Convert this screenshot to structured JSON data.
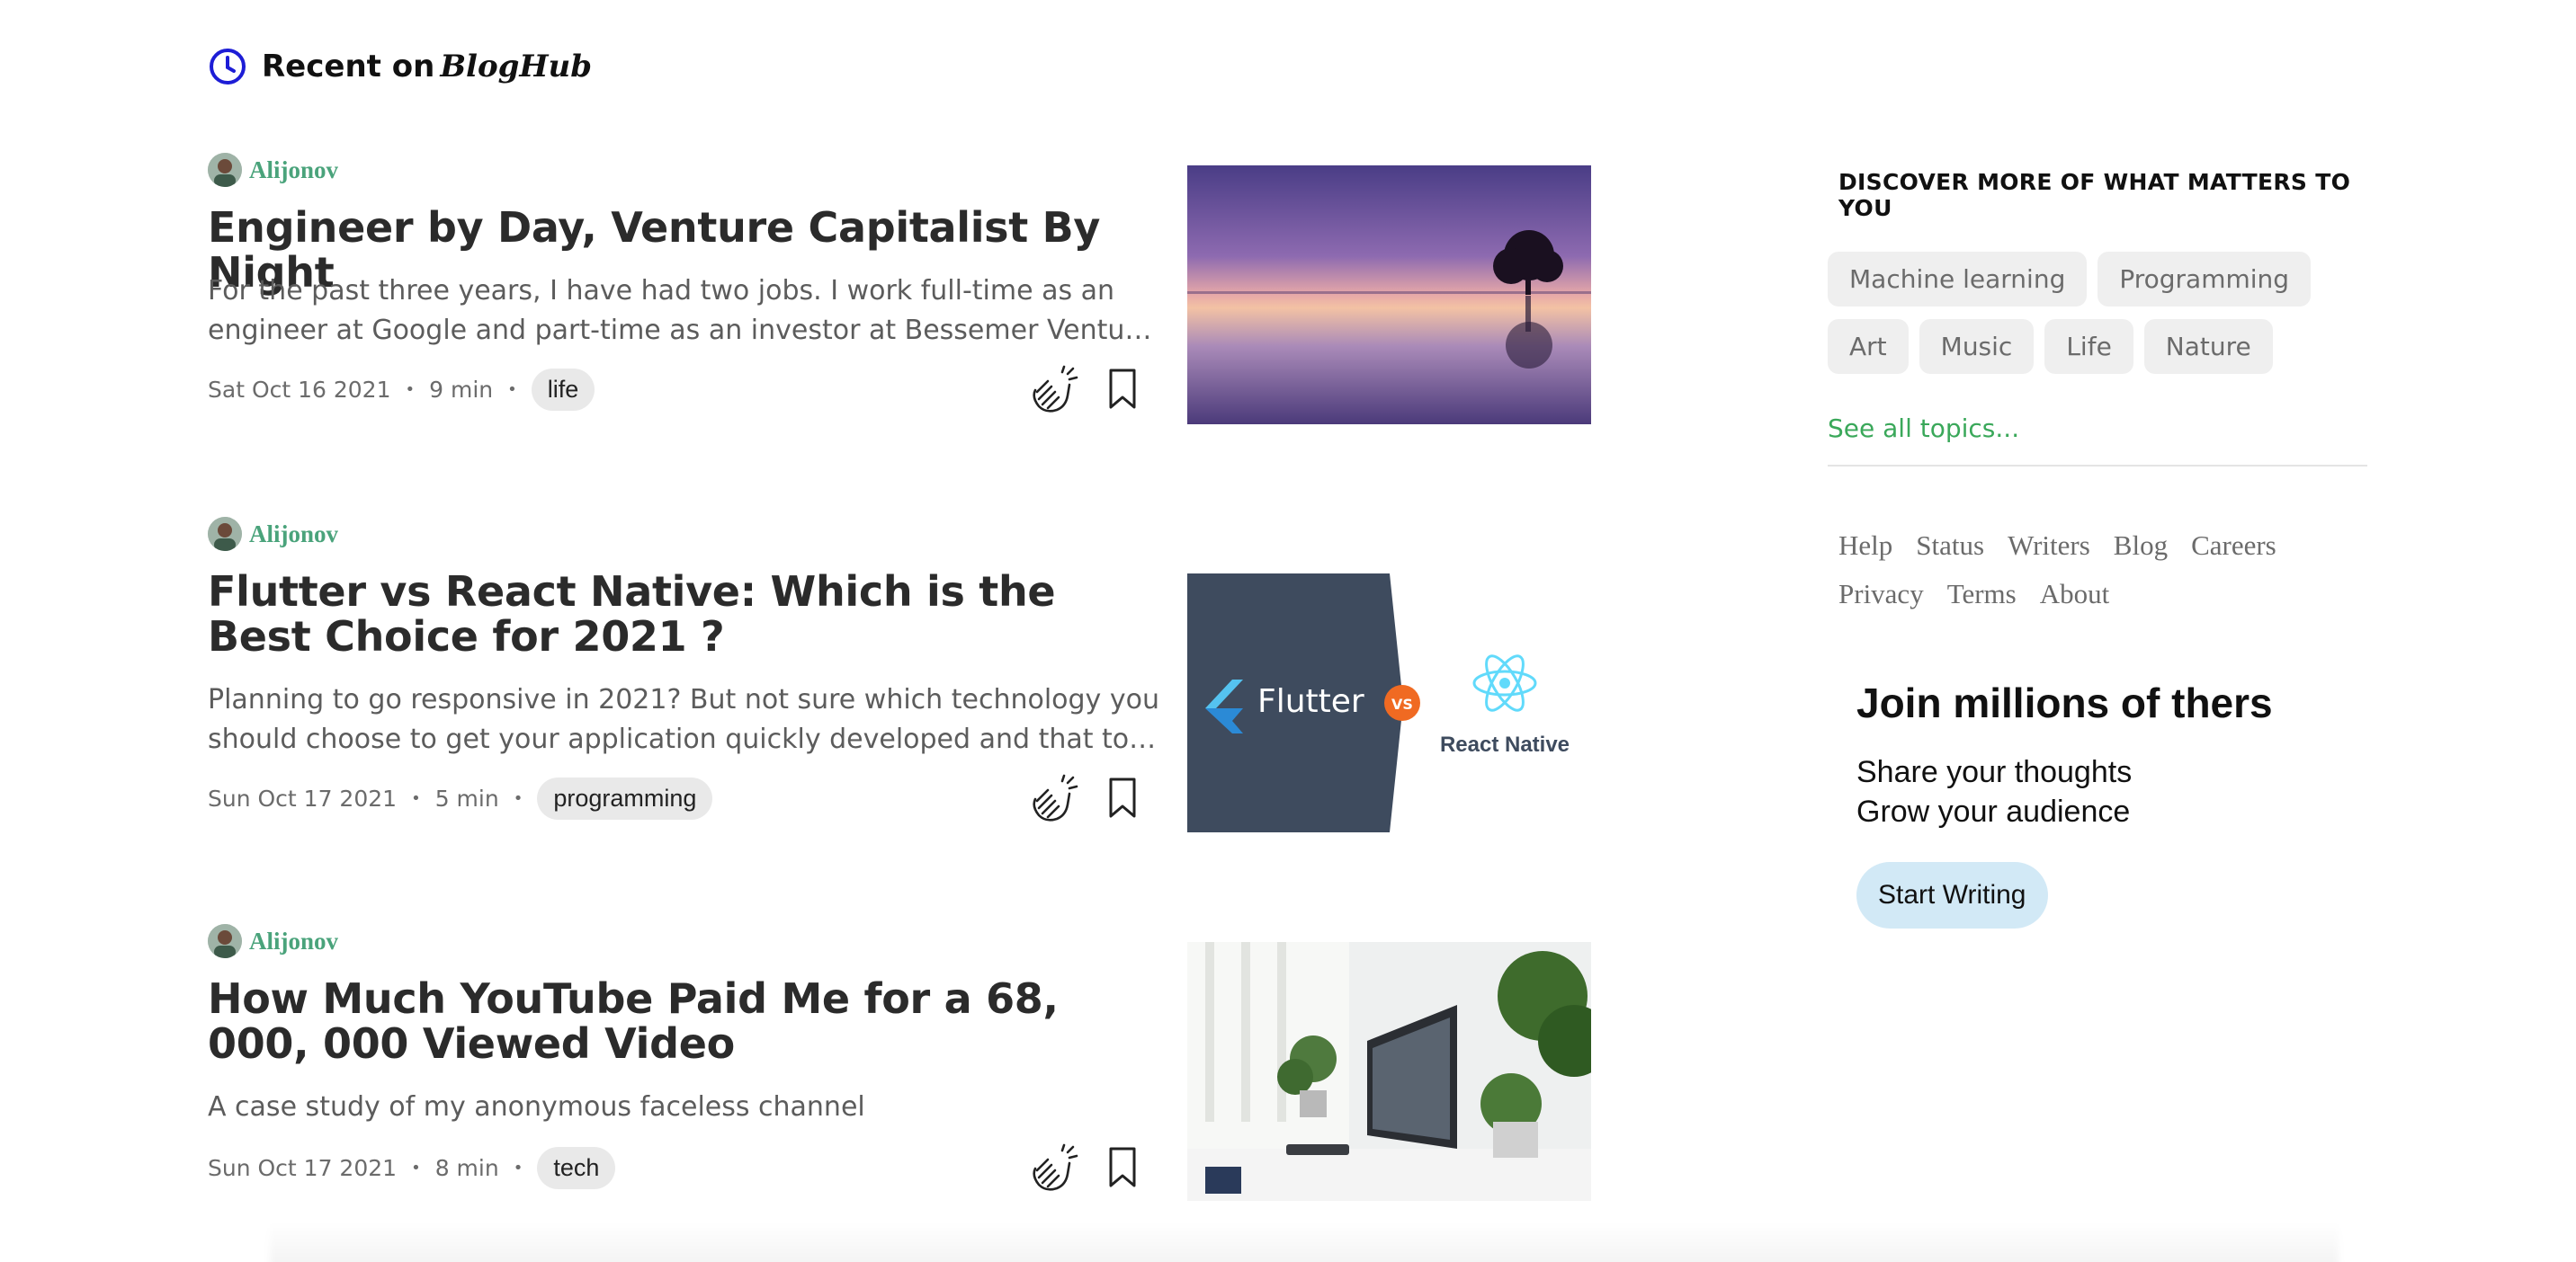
{
  "header": {
    "title": "Recent on",
    "brand": "BlogHub",
    "icon": "clock-icon",
    "accent": "#1d1dd6"
  },
  "articles": [
    {
      "author": "Alijonov",
      "title": "Engineer by Day, Venture Capitalist By Night",
      "excerpt": "For the past three years, I have had two jobs. I work full-time as an engineer at Google and part-time as an investor at Bessemer Venture Partners.",
      "date": "Sat Oct 16 2021",
      "read_time": "9 min",
      "tag": "life",
      "thumbnail": "sunset-lake-tree-image"
    },
    {
      "author": "Alijonov",
      "title": "Flutter vs React Native: Which is the Best Choice for 2021 ?",
      "excerpt": "Planning to go responsive in 2021? But not sure which technology you should choose to get your application quickly developed and that too at a reasonable cost?",
      "date": "Sun Oct 17 2021",
      "read_time": "5 min",
      "tag": "programming",
      "thumbnail": "flutter-vs-react-native-image",
      "thumb_text": {
        "left": "Flutter",
        "vs": "VS",
        "right": "React Native"
      }
    },
    {
      "author": "Alijonov",
      "title": "How Much YouTube Paid Me for a 68, 000, 000 Viewed Video",
      "excerpt": "A case study of my anonymous faceless channel",
      "date": "Sun Oct 17 2021",
      "read_time": "8 min",
      "tag": "tech",
      "thumbnail": "desk-monitor-plants-image"
    }
  ],
  "sidebar": {
    "discover_title": "DISCOVER MORE OF WHAT MATTERS TO YOU",
    "topics": [
      "Machine learning",
      "Programming",
      "Art",
      "Music",
      "Life",
      "Nature"
    ],
    "see_all": "See all topics...",
    "footer_links": [
      "Help",
      "Status",
      "Writers",
      "Blog",
      "Careers",
      "Privacy",
      "Terms",
      "About"
    ]
  },
  "join": {
    "title": "Join millions of thers",
    "line1": "Share your thoughts",
    "line2": "Grow your audience",
    "button": "Start Writing"
  },
  "colors": {
    "author": "#4aa37b",
    "see_all": "#3aa85a",
    "button_bg": "#d2e9f6",
    "tag_bg": "#e9e9e9"
  }
}
